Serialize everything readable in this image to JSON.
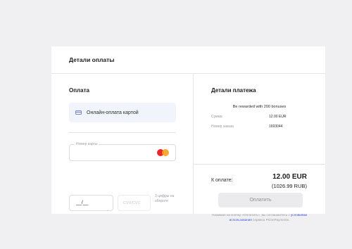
{
  "header": {
    "title": "Детали оплаты"
  },
  "payment": {
    "title": "Оплата",
    "method_label": "Онлайн-оплата картой",
    "method_icon": "card-icon",
    "card_number_label": "Номер карты",
    "expiry_value": "__/__",
    "cvv_placeholder": "CVV/CVC",
    "cvv_hint": "3 цифры на обороте",
    "card_brand_icon": "mastercard-icon"
  },
  "details": {
    "title": "Детали платежа",
    "bonus_text": "Be rewarded with 200 bonuses",
    "rows": [
      {
        "label": "Сумма",
        "value": "12.00 EUR"
      },
      {
        "label": "Номер заказа",
        "value": "1693044"
      }
    ],
    "total_label": "К оплате:",
    "total_value": "12.00 EUR",
    "total_rub": "(1026.99 RUB)",
    "pay_button": "Оплатить",
    "legal_prefix": "Нажимая на кнопку «Оплатить», вы соглашаетесь с",
    "legal_link": "условиями использования",
    "legal_suffix": "сервиса PrimePayments."
  },
  "colors": {
    "accent": "#3d4fd6",
    "mastercard_red": "#e8262b",
    "mastercard_orange": "#f6a21c",
    "method_bg": "#f2f4fb"
  }
}
